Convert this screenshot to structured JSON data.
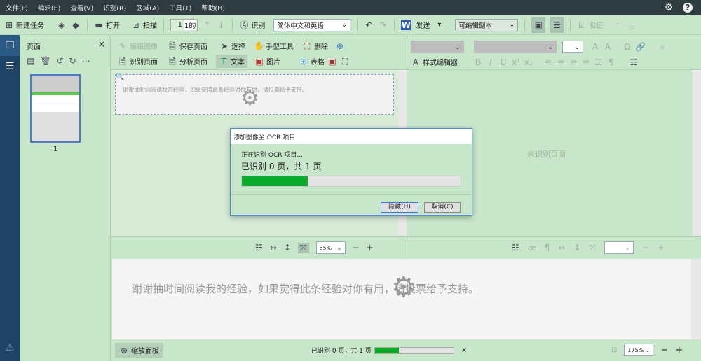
{
  "menu": [
    "文件(F)",
    "编辑(E)",
    "查看(V)",
    "识别(R)",
    "区域(A)",
    "工具(T)",
    "帮助(H)"
  ],
  "toolbar": {
    "new_task": "新建任务",
    "open": "打开",
    "scan": "扫描",
    "page_current": "1",
    "page_total": "1的",
    "recognize": "识别",
    "language": "简体中文和英语",
    "send": "发送",
    "output_mode": "可编辑副本",
    "verify": "验证"
  },
  "pages_panel": {
    "title": "页面",
    "thumb_label": "1"
  },
  "image_toolbar": {
    "edit_image": "编辑图像",
    "save_page": "保存页面",
    "recognize_page": "识别页面",
    "analyze_page": "分析页面",
    "select": "选择",
    "hand_tool": "手型工具",
    "delete": "删除",
    "text": "文本",
    "picture": "图片",
    "table": "表格"
  },
  "text_toolbar": {
    "style_editor": "样式编辑器",
    "bold": "B",
    "italic": "I",
    "underline": "U",
    "superscript": "x²",
    "subscript": "x₂"
  },
  "image_pane": {
    "text": "谢谢抽时间阅读我的经验，如果觉得此条经验对你有用，请投票给予支持。"
  },
  "text_pane": {
    "placeholder": "未识别页面"
  },
  "zoom_bar": {
    "zoom": "85%"
  },
  "zoom_pane": {
    "text": "谢谢抽时间阅读我的经验，如果觉得此条经验对你有用，请投票给予支持。"
  },
  "status": {
    "zoom_panel": "缩放面板",
    "progress_text": "已识别 0 页，共 1 页",
    "progress": 0.3,
    "zoom": "175%"
  },
  "dialog": {
    "title": "添加图像至 OCR 项目",
    "line1": "正在识别 OCR 项目...",
    "line2": "已识别 0 页，共 1 页",
    "progress": 0.3,
    "hide": "隐藏(H)",
    "cancel": "取消(C)"
  },
  "colors": {
    "progress": "#0aaa2a",
    "nav": "#1d4466",
    "menubar": "#2e3b40",
    "background": "#c8e6c9"
  }
}
